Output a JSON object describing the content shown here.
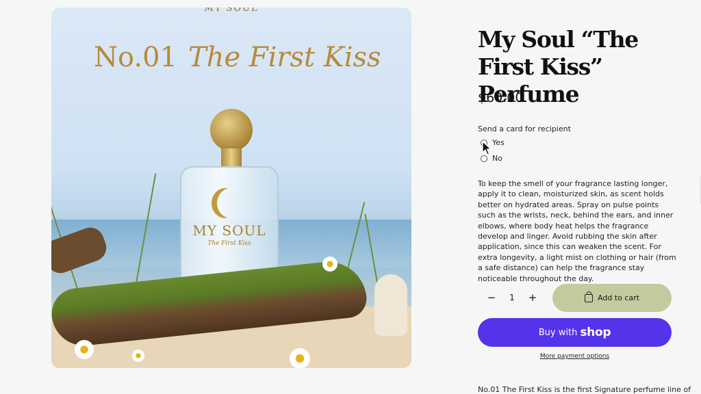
{
  "product": {
    "title": "My Soul “The First Kiss” Perfume",
    "price": "$60.00",
    "image_alt": "No.01 The First Kiss perfume bottle on mossy driftwood by the sea",
    "image_text": {
      "brand_top": "MY SOUL",
      "headline_number": "No.01",
      "headline_script": "The First Kiss",
      "bottle_brand": "MY SOUL",
      "bottle_sub": "The First Kiss"
    }
  },
  "card_option": {
    "label": "Send a card for recipient",
    "options": [
      "Yes",
      "No"
    ]
  },
  "description": "To keep the smell of your fragrance lasting longer, apply it to clean, moisturized skin, as scent holds better on hydrated areas. Spray on pulse points such as the wrists, neck, behind the ears, and inner elbows, where body heat helps the fragrance develop and linger. Avoid rubbing the skin after application, since this can weaken the scent. For extra longevity, a light mist on clothing or hair (from a safe distance) can help the fragrance stay noticeable throughout the day.",
  "quantity": {
    "minus": "−",
    "value": "1",
    "plus": "+"
  },
  "buttons": {
    "add_to_cart": "Add to cart",
    "buy_with": "Buy with",
    "shop": "shop",
    "more_payment": "More payment options"
  },
  "bottom_description": "No.01 The First Kiss is the first Signature perfume line of",
  "colors": {
    "add_to_cart_bg": "#c5c99e",
    "shop_pay_bg": "#5433eb",
    "page_bg": "#f5f7f7"
  }
}
